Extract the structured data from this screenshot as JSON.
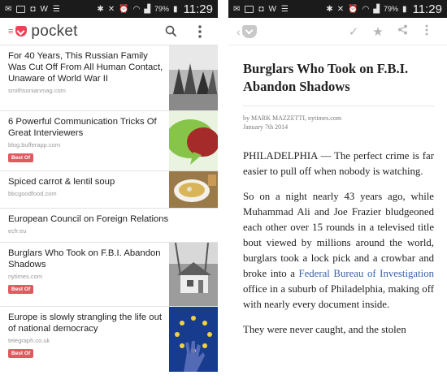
{
  "status_bar": {
    "battery": "79%",
    "time": "11:29"
  },
  "left": {
    "app_name": "pocket",
    "items": [
      {
        "title": "For 40 Years, This Russian Family Was Cut Off From All Human Contact, Unaware of World War II",
        "source": "smithsonianmag.com"
      },
      {
        "title": "6 Powerful Communication Tricks Of Great Interviewers",
        "source": "blog.bufferapp.com",
        "badge": "Best Of"
      },
      {
        "title": "Spiced carrot & lentil soup",
        "source": "bbcgoodfood.com"
      },
      {
        "title": "European Council on Foreign Relations",
        "source": "ecfr.eu"
      },
      {
        "title": "Burglars Who Took on F.B.I. Abandon Shadows",
        "source": "nytimes.com",
        "badge": "Best Of"
      },
      {
        "title": "Europe is slowly strangling the life out of national democracy",
        "source": "telegraph.co.uk",
        "badge": "Best Of"
      }
    ]
  },
  "right": {
    "title": "Burglars Who Took on F.B.I. Abandon Shadows",
    "byline": "by MARK MAZZETTI, nytimes.com",
    "date": "January 7th 2014",
    "p1": "PHILADELPHIA — The perfect crime is far easier to pull off when nobody is watching.",
    "p2_before": "So on a night nearly 43 years ago, while Muhammad Ali and Joe Frazier bludgeoned each other over 15 rounds in a televised title bout viewed by millions around the world, burglars took a lock pick and a crowbar and broke into a ",
    "p2_link": "Federal Bureau of Investigation",
    "p2_after": " office in a suburb of Philadelphia, making off with nearly every document inside.",
    "p3": "They were never caught, and the stolen"
  },
  "colors": {
    "brand": "#ee4056",
    "badge": "#e25a60",
    "link": "#3a62a8"
  }
}
